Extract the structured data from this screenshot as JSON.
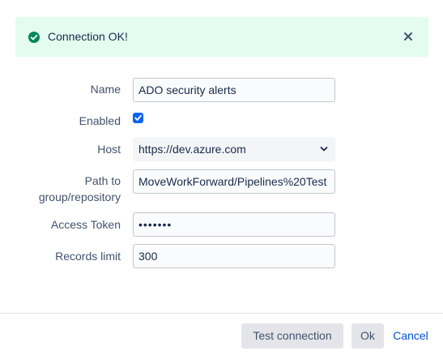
{
  "alert": {
    "message": "Connection OK!",
    "status_color": "#00875a"
  },
  "form": {
    "name": {
      "label": "Name",
      "value": "ADO security alerts"
    },
    "enabled": {
      "label": "Enabled",
      "checked": true
    },
    "host": {
      "label": "Host",
      "value": "https://dev.azure.com"
    },
    "path": {
      "label_line1": "Path to",
      "label_line2": "group/repository",
      "value": "MoveWorkForward/Pipelines%20Test"
    },
    "token": {
      "label": "Access Token",
      "value": "•••••••"
    },
    "records": {
      "label": "Records limit",
      "value": "300"
    }
  },
  "footer": {
    "test_label": "Test connection",
    "ok_label": "Ok",
    "cancel_label": "Cancel"
  },
  "colors": {
    "alert_bg": "#e3fcef",
    "primary_link": "#0052cc",
    "checkbox": "#0b65f2"
  }
}
